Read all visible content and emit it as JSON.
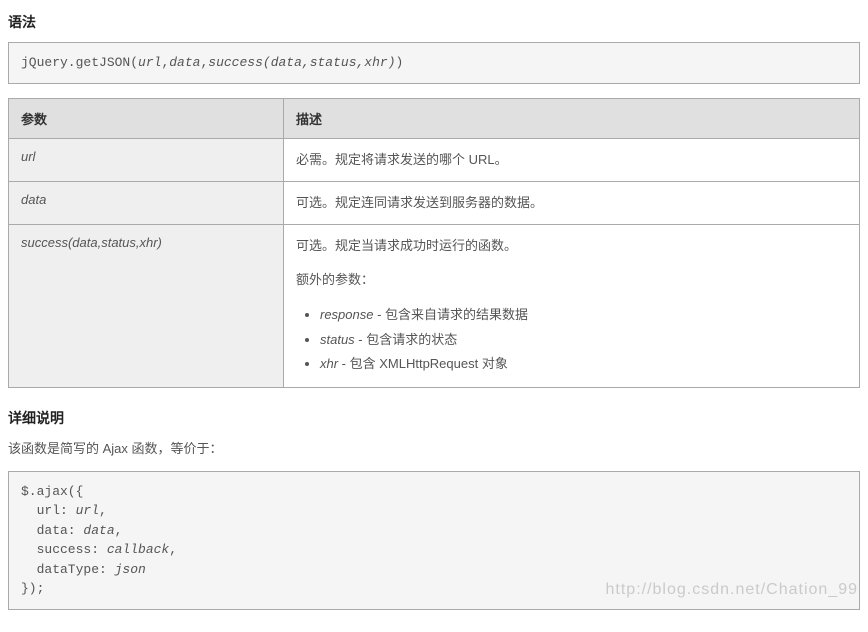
{
  "section1_title": "语法",
  "syntax_code": "jQuery.getJSON(url,data,success(data,status,xhr))",
  "table": {
    "head_param": "参数",
    "head_desc": "描述",
    "rows": [
      {
        "name": "url",
        "desc": "必需。规定将请求发送的哪个 URL。"
      },
      {
        "name": "data",
        "desc": "可选。规定连同请求发送到服务器的数据。"
      }
    ],
    "row3": {
      "name": "success(data,status,xhr)",
      "line1": "可选。规定当请求成功时运行的函数。",
      "line2": "额外的参数：",
      "bullets": [
        {
          "kw": "response",
          "tail": " - 包含来自请求的结果数据"
        },
        {
          "kw": "status",
          "tail": " - 包含请求的状态"
        },
        {
          "kw": "xhr",
          "tail": " - 包含 XMLHttpRequest 对象"
        }
      ]
    }
  },
  "section2_title": "详细说明",
  "section2_intro": "该函数是简写的 Ajax 函数，等价于：",
  "ajax_code": "$.ajax({\n  url: url,\n  data: data,\n  success: callback,\n  dataType: json\n});",
  "watermark": "http://blog.csdn.net/Chation_99"
}
